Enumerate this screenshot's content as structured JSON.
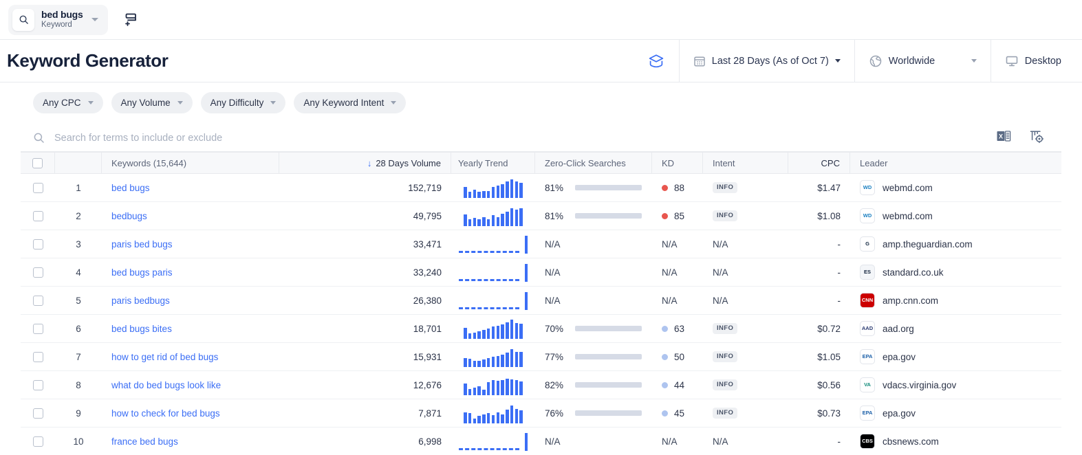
{
  "topbar": {
    "keyword_pill": {
      "title": "bed bugs",
      "subtitle": "Keyword",
      "search_icon": "search-icon",
      "caret_icon": "chevron-down-icon"
    },
    "add_list_icon": "add-to-list-icon"
  },
  "header": {
    "title": "Keyword Generator",
    "ai_icon": "ai-assistant-icon",
    "date_range": {
      "label": "Last 28 Days (As of Oct 7)",
      "icon": "calendar-icon"
    },
    "location": {
      "label": "Worldwide",
      "icon": "globe-icon"
    },
    "device": {
      "label": "Desktop",
      "icon": "desktop-icon"
    }
  },
  "filters": [
    {
      "label": "Any CPC",
      "name": "filter-cpc"
    },
    {
      "label": "Any Volume",
      "name": "filter-volume"
    },
    {
      "label": "Any Difficulty",
      "name": "filter-difficulty"
    },
    {
      "label": "Any Keyword Intent",
      "name": "filter-keyword-intent"
    }
  ],
  "search": {
    "placeholder": "Search for terms to include or exclude",
    "value": "",
    "icon": "search-icon",
    "export_icon": "excel-export-icon",
    "settings_icon": "table-settings-icon"
  },
  "table": {
    "columns": {
      "keywords": "Keywords (15,644)",
      "volume": "28 Days Volume",
      "volume_sort": "↓",
      "trend": "Yearly Trend",
      "zero_click": "Zero-Click Searches",
      "kd": "KD",
      "intent": "Intent",
      "cpc": "CPC",
      "leader": "Leader"
    },
    "rows": [
      {
        "num": "1",
        "keyword": "bed bugs",
        "volume": "152,719",
        "trend": [
          16,
          9,
          12,
          9,
          10,
          10,
          16,
          18,
          20,
          24,
          27,
          24,
          22
        ],
        "trend_na": false,
        "zero_click": "81%",
        "zero_click_pct": 81,
        "kd": "88",
        "kd_color": "#e8564e",
        "intent": "INFO",
        "cpc": "$1.47",
        "leader": "webmd.com",
        "fav_text": "WD",
        "fav_bg": "#ffffff",
        "fav_fg": "#1a7fc1"
      },
      {
        "num": "2",
        "keyword": "bedbugs",
        "volume": "49,795",
        "trend": [
          17,
          10,
          12,
          10,
          13,
          10,
          16,
          13,
          18,
          21,
          26,
          24,
          26
        ],
        "trend_na": false,
        "zero_click": "81%",
        "zero_click_pct": 81,
        "kd": "85",
        "kd_color": "#e8564e",
        "intent": "INFO",
        "cpc": "$1.08",
        "leader": "webmd.com",
        "fav_text": "WD",
        "fav_bg": "#ffffff",
        "fav_fg": "#1a7fc1"
      },
      {
        "num": "3",
        "keyword": "paris bed bugs",
        "volume": "33,471",
        "trend": [],
        "trend_na": true,
        "zero_click": "N/A",
        "zero_click_pct": null,
        "kd": "N/A",
        "kd_color": null,
        "intent": "N/A",
        "cpc": "-",
        "leader": "amp.theguardian.com",
        "fav_text": "G",
        "fav_bg": "#ffffff",
        "fav_fg": "#10253f"
      },
      {
        "num": "4",
        "keyword": "bed bugs paris",
        "volume": "33,240",
        "trend": [],
        "trend_na": true,
        "zero_click": "N/A",
        "zero_click_pct": null,
        "kd": "N/A",
        "kd_color": null,
        "intent": "N/A",
        "cpc": "-",
        "leader": "standard.co.uk",
        "fav_text": "ES",
        "fav_bg": "#f4f6f9",
        "fav_fg": "#12233d"
      },
      {
        "num": "5",
        "keyword": "paris bedbugs",
        "volume": "26,380",
        "trend": [],
        "trend_na": true,
        "zero_click": "N/A",
        "zero_click_pct": null,
        "kd": "N/A",
        "kd_color": null,
        "intent": "N/A",
        "cpc": "-",
        "leader": "amp.cnn.com",
        "fav_text": "CNN",
        "fav_bg": "#cc0000",
        "fav_fg": "#ffffff"
      },
      {
        "num": "6",
        "keyword": "bed bugs bites",
        "volume": "18,701",
        "trend": [
          16,
          8,
          9,
          11,
          13,
          15,
          18,
          19,
          21,
          24,
          28,
          23,
          22
        ],
        "trend_na": false,
        "zero_click": "70%",
        "zero_click_pct": 70,
        "kd": "63",
        "kd_color": "#aec4ef",
        "intent": "INFO",
        "cpc": "$0.72",
        "leader": "aad.org",
        "fav_text": "AAD",
        "fav_bg": "#ffffff",
        "fav_fg": "#2b3b72"
      },
      {
        "num": "7",
        "keyword": "how to get rid of bed bugs",
        "volume": "15,931",
        "trend": [
          13,
          12,
          9,
          9,
          11,
          13,
          15,
          16,
          18,
          21,
          26,
          22,
          22
        ],
        "trend_na": false,
        "zero_click": "77%",
        "zero_click_pct": 77,
        "kd": "50",
        "kd_color": "#aec4ef",
        "intent": "INFO",
        "cpc": "$1.05",
        "leader": "epa.gov",
        "fav_text": "EPA",
        "fav_bg": "#ffffff",
        "fav_fg": "#1b5fa8"
      },
      {
        "num": "8",
        "keyword": "what do bed bugs look like",
        "volume": "12,676",
        "trend": [
          17,
          9,
          11,
          13,
          8,
          19,
          22,
          21,
          22,
          24,
          23,
          22,
          20
        ],
        "trend_na": false,
        "zero_click": "82%",
        "zero_click_pct": 82,
        "kd": "44",
        "kd_color": "#aec4ef",
        "intent": "INFO",
        "cpc": "$0.56",
        "leader": "vdacs.virginia.gov",
        "fav_text": "VA",
        "fav_bg": "#ffffff",
        "fav_fg": "#108a7a"
      },
      {
        "num": "9",
        "keyword": "how to check for bed bugs",
        "volume": "7,871",
        "trend": [
          16,
          15,
          7,
          11,
          13,
          15,
          12,
          16,
          13,
          20,
          26,
          21,
          19
        ],
        "trend_na": false,
        "zero_click": "76%",
        "zero_click_pct": 76,
        "kd": "45",
        "kd_color": "#aec4ef",
        "intent": "INFO",
        "cpc": "$0.73",
        "leader": "epa.gov",
        "fav_text": "EPA",
        "fav_bg": "#ffffff",
        "fav_fg": "#1b5fa8"
      },
      {
        "num": "10",
        "keyword": "france bed bugs",
        "volume": "6,998",
        "trend": [],
        "trend_na": true,
        "zero_click": "N/A",
        "zero_click_pct": null,
        "kd": "N/A",
        "kd_color": null,
        "intent": "N/A",
        "cpc": "-",
        "leader": "cbsnews.com",
        "fav_text": "CBS",
        "fav_bg": "#000000",
        "fav_fg": "#ffffff"
      }
    ]
  },
  "colors": {
    "accent": "#3b6ef5",
    "kd_high": "#e8564e",
    "kd_low": "#aec4ef",
    "track": "#d6dbe6"
  }
}
